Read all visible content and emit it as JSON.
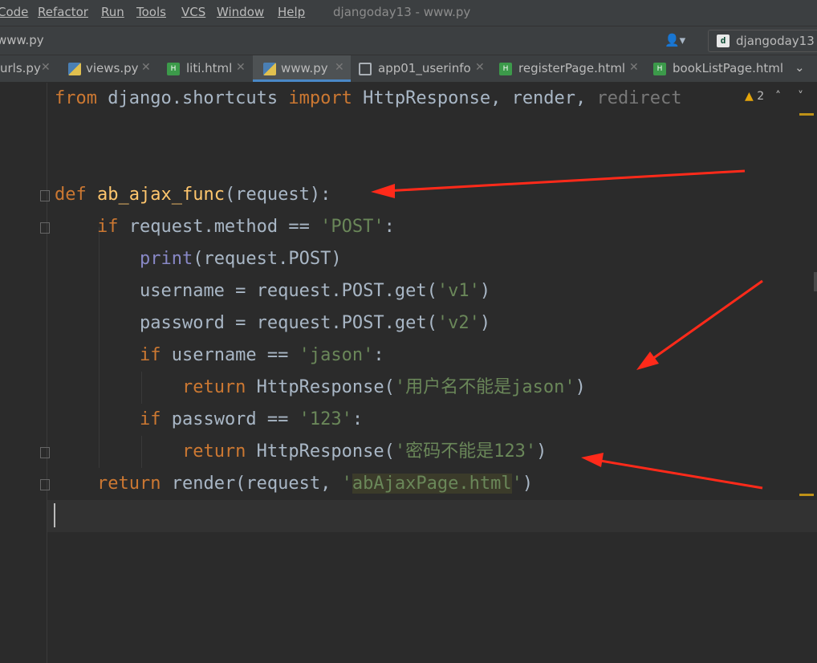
{
  "menu": {
    "items": [
      "Code",
      "Refactor",
      "Run",
      "Tools",
      "VCS",
      "Window",
      "Help"
    ],
    "window_title": "djangoday13 - www.py"
  },
  "navbar": {
    "breadcrumb": "www.py",
    "user_icon": "user-icon",
    "project": "djangoday13"
  },
  "tabs": [
    {
      "label": "urls.py",
      "icon": "python-file-icon"
    },
    {
      "label": "views.py",
      "icon": "python-file-icon"
    },
    {
      "label": "liti.html",
      "icon": "html-file-icon"
    },
    {
      "label": "www.py",
      "icon": "python-file-icon",
      "active": true
    },
    {
      "label": "app01_userinfo",
      "icon": "table-icon"
    },
    {
      "label": "registerPage.html",
      "icon": "html-file-icon"
    },
    {
      "label": "bookListPage.html",
      "icon": "html-file-icon"
    }
  ],
  "inspection": {
    "warnings": "2"
  },
  "code": {
    "l1": {
      "kw1": "from",
      "mod": " django.shortcuts ",
      "kw2": "import",
      "names": " HttpResponse, render, ",
      "unused": "redirect"
    },
    "l4": {
      "kw": "def",
      "sp": " ",
      "fn": "ab_ajax_func",
      "rest": "(request):"
    },
    "l5": {
      "ind": "    ",
      "kw": "if",
      "rest": " request.method == ",
      "str": "'POST'",
      "end": ":"
    },
    "l6": {
      "ind": "        ",
      "bi": "print",
      "rest": "(request.POST)"
    },
    "l7": {
      "ind": "        ",
      "rest": "username = request.POST.get(",
      "str": "'v1'",
      "end": ")"
    },
    "l8": {
      "ind": "        ",
      "rest": "password = request.POST.get(",
      "str": "'v2'",
      "end": ")"
    },
    "l9": {
      "ind": "        ",
      "kw": "if",
      "rest": " username == ",
      "str": "'jason'",
      "end": ":"
    },
    "l10": {
      "ind": "            ",
      "kw": "return",
      "rest": " HttpResponse(",
      "str": "'用户名不能是jason'",
      "end": ")"
    },
    "l11": {
      "ind": "        ",
      "kw": "if",
      "rest": " password == ",
      "str": "'123'",
      "end": ":"
    },
    "l12": {
      "ind": "            ",
      "kw": "return",
      "rest": " HttpResponse(",
      "str": "'密码不能是123'",
      "end": ")"
    },
    "l13": {
      "ind": "    ",
      "kw": "return",
      "rest": " render(request, ",
      "q1": "'",
      "hl": "abAjaxPage.html",
      "q2": "'",
      "end": ")"
    }
  }
}
